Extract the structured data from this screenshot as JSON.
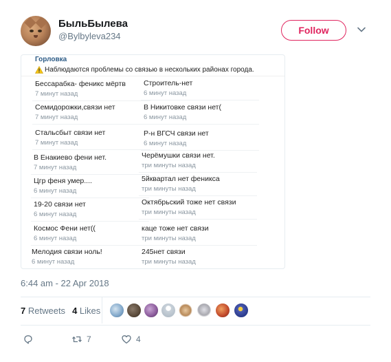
{
  "profile": {
    "display_name": "БыльБылева",
    "handle": "@Bylbyleva234",
    "follow_label": "Follow"
  },
  "card": {
    "header": "Горловка",
    "warning": "Наблюдаются проблемы со связью в нескольких районах города.",
    "messages": [
      {
        "text": "Бессарабка- феникс мёртв",
        "time": "7 минут назад"
      },
      {
        "text": "Строитель-нет",
        "time": "6 минут назад"
      },
      {
        "text": "Семидорожки,связи нет",
        "time": "7 минут назад"
      },
      {
        "text": "В Никитовке связи нет(",
        "time": "6 минут назад"
      },
      {
        "text": "Стальсбыт связи нет",
        "time": "7 минут назад"
      },
      {
        "text": "Р-н ВГСЧ связи нет",
        "time": "6 минут назад"
      },
      {
        "text": "В Енакиево фени нет.",
        "time": "7 минут назад"
      },
      {
        "text": "Черёмушки связи нет.",
        "time": "три минуты назад"
      },
      {
        "text": "Цгр феня умер....",
        "time": "6 минут назад"
      },
      {
        "text": "5йквартал нет феникса",
        "time": "три минуты назад"
      },
      {
        "text": "19-20 связи нет",
        "time": "6 минут назад"
      },
      {
        "text": "Октябрьский тоже нет связи",
        "time": "три минуты назад"
      },
      {
        "text": "Космос Фени нет((",
        "time": "6 минут назад"
      },
      {
        "text": "каце тоже нет связи",
        "time": "три минуты назад"
      },
      {
        "text": "Мелодия связи ноль!",
        "time": "6 минут назад"
      },
      {
        "text": "245нет связи",
        "time": "три минуты назад"
      }
    ]
  },
  "tweet": {
    "timestamp": "6:44 am - 22 Apr 2018",
    "retweets_count": "7",
    "retweets_label": "Retweets",
    "likes_count": "4",
    "likes_label": "Likes"
  },
  "likers": [
    {
      "icon": "avatar-1",
      "color": "#7fa6c9"
    },
    {
      "icon": "avatar-2",
      "color": "#5a4a3a"
    },
    {
      "icon": "avatar-3",
      "color": "#8a5a9a"
    },
    {
      "icon": "avatar-4",
      "color": "#c9d2da"
    },
    {
      "icon": "avatar-5",
      "color": "#b88a5a"
    },
    {
      "icon": "avatar-6",
      "color": "#a9a9b0"
    },
    {
      "icon": "avatar-7",
      "color": "#c0472a"
    },
    {
      "icon": "avatar-8",
      "color": "#2a3a8a"
    }
  ],
  "actions": {
    "reply_icon": "reply-icon",
    "retweet_count": "7",
    "like_count": "4"
  },
  "colors": {
    "follow_accent": "#e0245e",
    "muted": "#657786"
  }
}
